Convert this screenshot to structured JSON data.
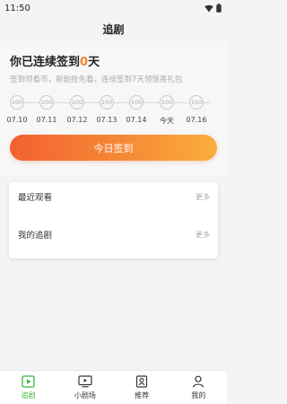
{
  "status_bar": {
    "time": "11:50"
  },
  "header": {
    "title": "追剧"
  },
  "checkin": {
    "title_prefix": "你已连续签到",
    "days": "0",
    "title_suffix": "天",
    "subtitle": "签到领看币，新剧抢先看。连续签到7天领惊喜礼包",
    "coins": [
      "100",
      "100",
      "100",
      "100",
      "100",
      "100",
      "150"
    ],
    "dates": [
      "07.10",
      "07.11",
      "07.12",
      "07.13",
      "07.14",
      "今天",
      "07.16"
    ],
    "button_label": "今日签到",
    "accent_color": "#f2862e"
  },
  "lists": [
    {
      "label": "最近观看",
      "more": "更多"
    },
    {
      "label": "我的追剧",
      "more": "更多"
    }
  ],
  "bottom_nav": {
    "items": [
      {
        "label": "追剧",
        "icon": "play-square-icon",
        "active": true
      },
      {
        "label": "小剧场",
        "icon": "tv-icon",
        "active": false
      },
      {
        "label": "推荐",
        "icon": "recommend-icon",
        "active": false
      },
      {
        "label": "我的",
        "icon": "person-icon",
        "active": false
      }
    ],
    "active_color": "#3bb53e"
  }
}
